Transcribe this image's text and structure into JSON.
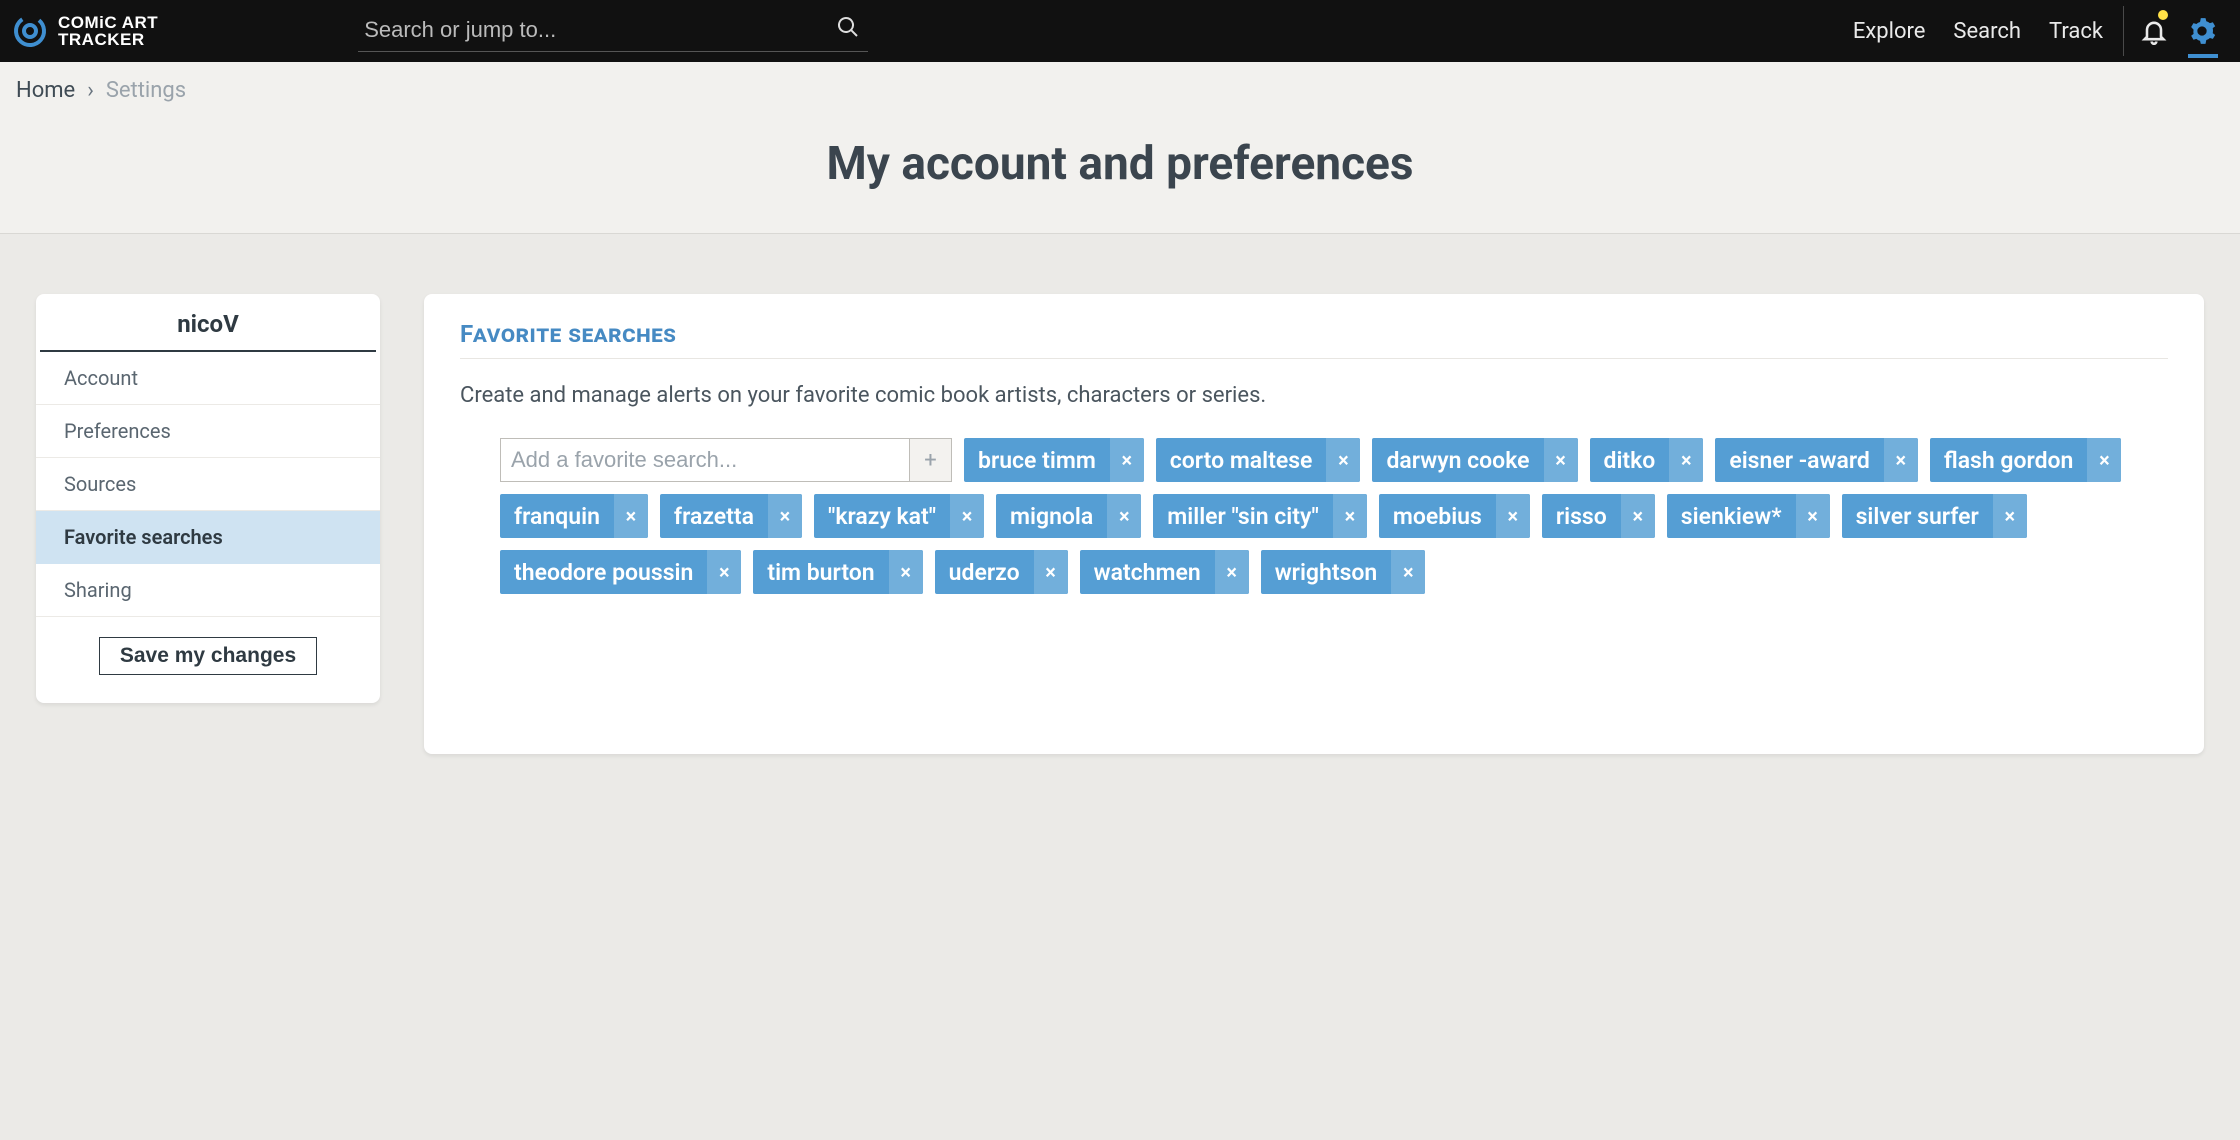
{
  "brand": {
    "line1": "COMiC ART",
    "line2": "TRACKER"
  },
  "search": {
    "placeholder": "Search or jump to..."
  },
  "nav": {
    "explore": "Explore",
    "search": "Search",
    "track": "Track"
  },
  "breadcrumb": {
    "home": "Home",
    "sep": "›",
    "current": "Settings"
  },
  "page_title": "My account and preferences",
  "sidebar": {
    "user": "nicoV",
    "items": [
      {
        "label": "Account",
        "active": false
      },
      {
        "label": "Preferences",
        "active": false
      },
      {
        "label": "Sources",
        "active": false
      },
      {
        "label": "Favorite searches",
        "active": true
      },
      {
        "label": "Sharing",
        "active": false
      }
    ],
    "save_label": "Save my changes"
  },
  "panel": {
    "title": "Favorite searches",
    "desc": "Create and manage alerts on your favorite comic book artists, characters or series.",
    "add_placeholder": "Add a favorite search...",
    "add_btn": "+",
    "close_glyph": "×",
    "tags": [
      "bruce timm",
      "corto maltese",
      "darwyn cooke",
      "ditko",
      "eisner -award",
      "flash gordon",
      "franquin",
      "frazetta",
      "\"krazy kat\"",
      "mignola",
      "miller \"sin city\"",
      "moebius",
      "risso",
      "sienkiew*",
      "silver surfer",
      "theodore poussin",
      "tim burton",
      "uderzo",
      "watchmen",
      "wrightson"
    ]
  }
}
